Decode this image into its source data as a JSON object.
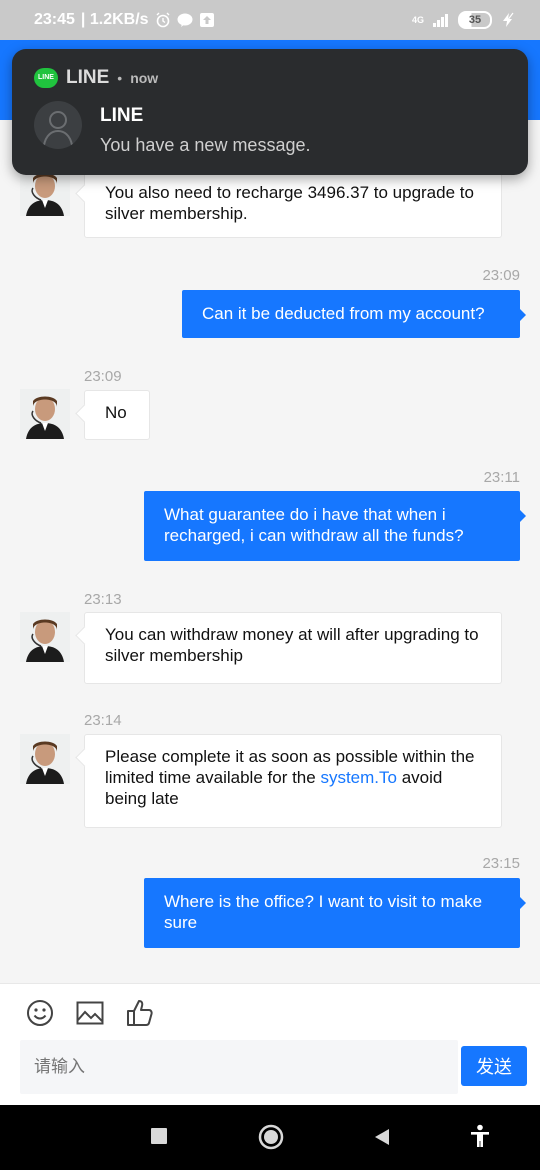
{
  "status_bar": {
    "time": "23:45",
    "speed": "| 1.2KB/s",
    "network": "4G",
    "battery": "35"
  },
  "notification": {
    "app_name": "LINE",
    "separator": "•",
    "time": "now",
    "title": "LINE",
    "body": "You have a new message."
  },
  "messages": [
    {
      "side": "in",
      "text": "You also need to recharge 3496.37 to upgrade to silver membership."
    },
    {
      "side": "out",
      "time": "23:09",
      "text": "Can it be deducted from my account?"
    },
    {
      "side": "in",
      "time": "23:09",
      "text": "No"
    },
    {
      "side": "out",
      "time": "23:11",
      "text": "What guarantee do i have that when i recharged, i can withdraw all the funds?"
    },
    {
      "side": "in",
      "time": "23:13",
      "text": "You can withdraw money at will after upgrading to silver membership"
    },
    {
      "side": "in",
      "time": "23:14",
      "text_before": "Please complete it as soon as possible within the limited time available for the ",
      "link": "system.To",
      "text_after": " avoid being late"
    },
    {
      "side": "out",
      "time": "23:15",
      "text": "Where is the office? I want to visit to make sure"
    }
  ],
  "composer": {
    "icons": [
      "emoji-icon",
      "image-icon",
      "thumbs-up-icon"
    ],
    "placeholder": "请输入",
    "send_label": "发送"
  },
  "colors": {
    "accent": "#1677ff",
    "line_green": "#20c33e"
  }
}
